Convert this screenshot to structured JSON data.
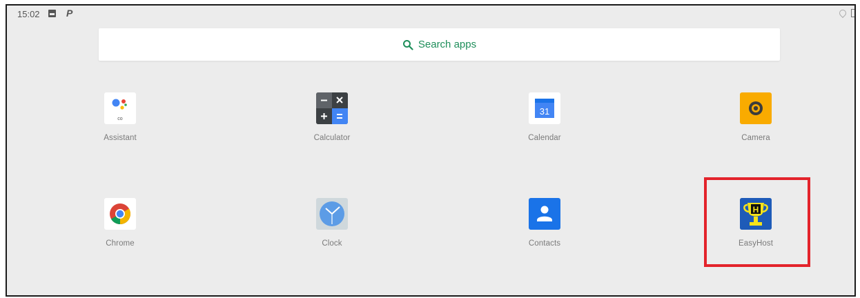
{
  "status_bar": {
    "time": "15:02",
    "icons": [
      "image-icon",
      "p-icon",
      "wifi-icon",
      "battery-icon"
    ],
    "p_glyph": "P"
  },
  "search": {
    "label": "Search apps",
    "accent_color": "#1e8e5a"
  },
  "apps": [
    {
      "label": "Assistant",
      "icon": "assistant-icon"
    },
    {
      "label": "Calculator",
      "icon": "calculator-icon"
    },
    {
      "label": "Calendar",
      "icon": "calendar-icon",
      "icon_text": "31"
    },
    {
      "label": "Camera",
      "icon": "camera-icon"
    },
    {
      "label": "Chrome",
      "icon": "chrome-icon"
    },
    {
      "label": "Clock",
      "icon": "clock-icon"
    },
    {
      "label": "Contacts",
      "icon": "contacts-icon"
    },
    {
      "label": "EasyHost",
      "icon": "easyhost-icon",
      "icon_text": "H",
      "highlighted": true
    }
  ],
  "highlight_color": "#e3232b"
}
